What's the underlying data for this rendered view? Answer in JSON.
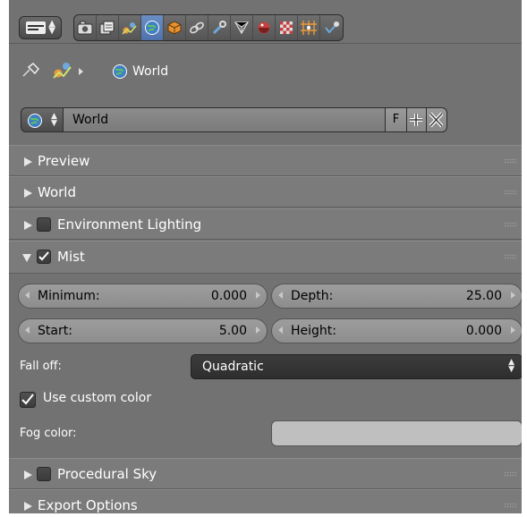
{
  "context": {
    "path_label": "World"
  },
  "datablock": {
    "name_value": "World",
    "fake_user_label": "F"
  },
  "panels": {
    "preview": "Preview",
    "world": "World",
    "environment_lighting": "Environment Lighting",
    "mist": "Mist",
    "procedural_sky": "Procedural Sky",
    "export_options": "Export Options"
  },
  "panel_states": {
    "environment_lighting_enabled": false,
    "mist_enabled": true,
    "procedural_sky_enabled": false
  },
  "mist": {
    "minimum": {
      "label": "Minimum:",
      "value": "0.000"
    },
    "depth": {
      "label": "Depth:",
      "value": "25.00"
    },
    "start": {
      "label": "Start:",
      "value": "5.00"
    },
    "height": {
      "label": "Height:",
      "value": "0.000"
    },
    "falloff_label": "Fall off:",
    "falloff_value": "Quadratic",
    "use_custom_color_label": "Use custom color",
    "use_custom_color": true,
    "fog_color_label": "Fog color:",
    "fog_color": "#bfbfbf"
  },
  "colors": {
    "background": "#727272",
    "active_tab": "#5a7fbd"
  },
  "toolbar_tabs": [
    "render-icon",
    "render-layers-icon",
    "scene-icon",
    "world-icon",
    "object-icon",
    "constraints-icon",
    "modifiers-icon",
    "mesh-data-icon",
    "material-icon",
    "texture-icon",
    "particles-icon",
    "physics-icon"
  ]
}
